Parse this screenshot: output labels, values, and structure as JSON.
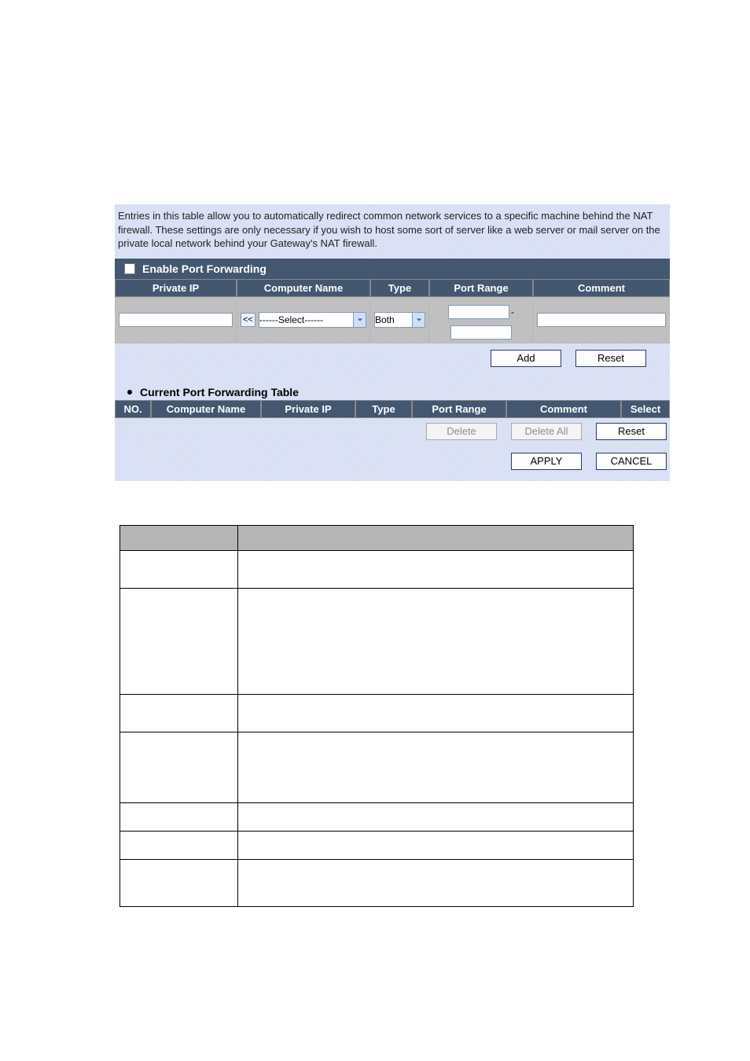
{
  "intro": "Entries in this table allow you to automatically redirect common network services to a specific machine behind the NAT firewall. These settings are only necessary if you wish to host some sort of server like a web server or mail server on the private local network behind your Gateway's NAT firewall.",
  "enable_label": "Enable Port Forwarding",
  "form_headers": {
    "private_ip": "Private IP",
    "computer_name": "Computer Name",
    "type": "Type",
    "port_range": "Port Range",
    "comment": "Comment"
  },
  "copy_btn": "<<",
  "computer_select_placeholder": "------Select------",
  "type_value": "Both",
  "add_btn": "Add",
  "reset_btn": "Reset",
  "table_title": "Current Port Forwarding Table",
  "table_headers": {
    "no": "NO.",
    "computer_name": "Computer Name",
    "private_ip": "Private IP",
    "type": "Type",
    "port_range": "Port Range",
    "comment": "Comment",
    "select": "Select"
  },
  "delete_btn": "Delete",
  "delete_all_btn": "Delete All",
  "apply_btn": "APPLY",
  "cancel_btn": "CANCEL"
}
